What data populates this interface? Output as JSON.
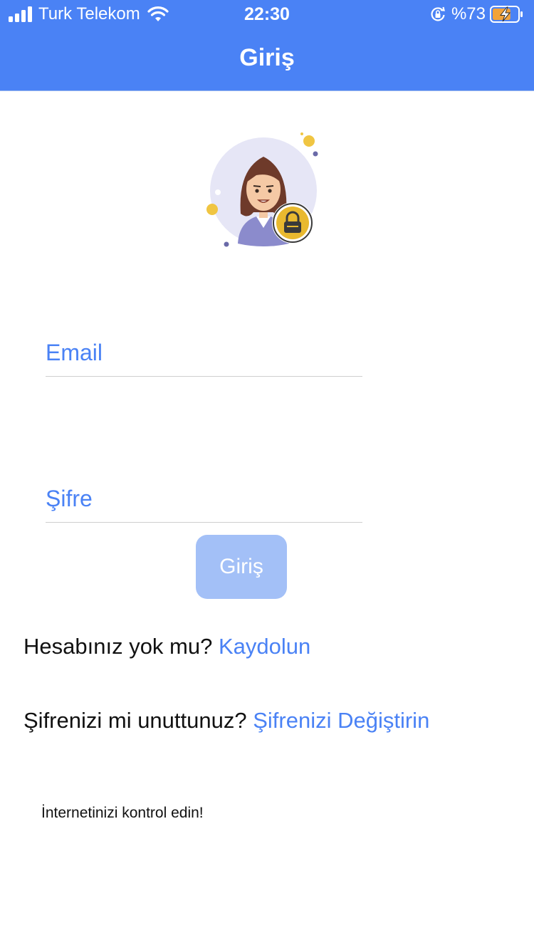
{
  "status_bar": {
    "carrier": "Turk Telekom",
    "time": "22:30",
    "battery_percent": "%73",
    "battery_level": 0.73,
    "icons": [
      "signal-icon",
      "wifi-icon",
      "orientation-lock-icon",
      "battery-charging-icon"
    ]
  },
  "nav": {
    "title": "Giriş"
  },
  "form": {
    "email_placeholder": "Email",
    "email_value": "",
    "password_placeholder": "Şifre",
    "password_value": "",
    "login_button": "Giriş"
  },
  "register": {
    "question": "Hesabınız yok mu?",
    "link": "Kaydolun"
  },
  "forgot": {
    "question": "Şifrenizi mi unuttunuz?",
    "link": "Şifrenizi Değiştirin"
  },
  "error_message": "İnternetinizi kontrol edin!",
  "colors": {
    "accent": "#4a82f5",
    "button_disabled": "#a3c0f7",
    "text": "#111111",
    "lock_badge": "#e9b92f"
  }
}
